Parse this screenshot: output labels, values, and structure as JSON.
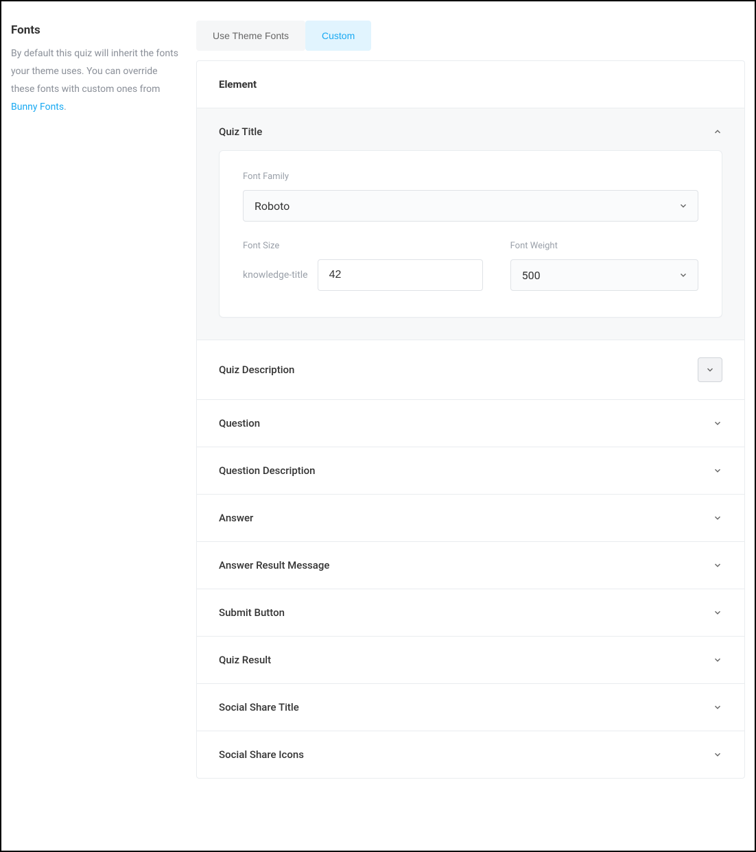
{
  "sidebar": {
    "title": "Fonts",
    "desc_prefix": "By default this quiz will inherit the fonts your theme uses. You can override these fonts with custom ones from ",
    "link_text": "Bunny Fonts",
    "desc_suffix": "."
  },
  "tabs": {
    "theme": "Use Theme Fonts",
    "custom": "Custom"
  },
  "panel": {
    "header": "Element"
  },
  "quiz_title": {
    "label": "Quiz Title",
    "font_family_label": "Font Family",
    "font_family_value": "Roboto",
    "font_size_label": "Font Size",
    "font_size_prefix": "knowledge-title",
    "font_size_value": "42",
    "font_weight_label": "Font Weight",
    "font_weight_value": "500"
  },
  "sections": {
    "quiz_description": "Quiz Description",
    "question": "Question",
    "question_description": "Question Description",
    "answer": "Answer",
    "answer_result_message": "Answer Result Message",
    "submit_button": "Submit Button",
    "quiz_result": "Quiz Result",
    "social_share_title": "Social Share Title",
    "social_share_icons": "Social Share Icons"
  }
}
